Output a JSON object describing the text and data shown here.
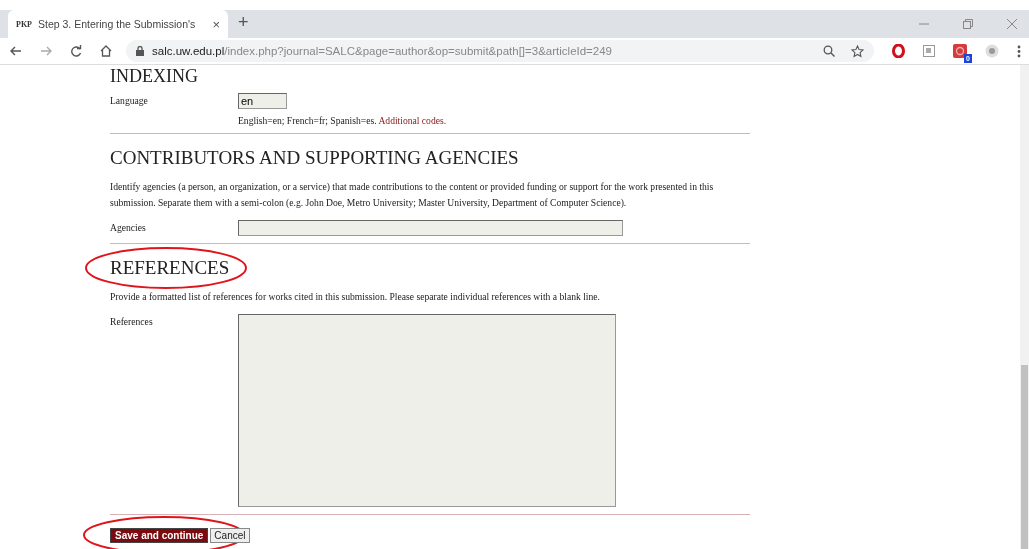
{
  "browser": {
    "tab": {
      "favicon": "PKP",
      "title": "Step 3. Entering the Submission's",
      "close": "×"
    },
    "new_tab": "+",
    "url_host": "salc.uw.edu.pl",
    "url_path": "/index.php?journal=SALC&page=author&op=submit&path[]=3&articleId=249",
    "extension_badge": "0"
  },
  "sections": [
    {
      "heading": "INDEXING",
      "fields": [
        {
          "kind": "text",
          "label": "Language",
          "value": "en",
          "hint": "English=en; French=fr; Spanish=es.",
          "hint_link": "Additional codes."
        }
      ]
    },
    {
      "heading": "CONTRIBUTORS AND SUPPORTING AGENCIES",
      "description": "Identify agencies (a person, an organization, or a service) that made contributions to the content or provided funding or support for the work presented in this submission. Separate them with a semi-colon (e.g. John Doe, Metro University; Master University, Department of Computer Science).",
      "fields": [
        {
          "kind": "wide",
          "label": "Agencies"
        }
      ]
    },
    {
      "heading": "REFERENCES",
      "highlighted": true,
      "description": "Provide a formatted list of references for works cited in this submission. Please separate individual references with a blank line.",
      "fields": [
        {
          "kind": "textarea",
          "label": "References"
        }
      ]
    }
  ],
  "buttons": [
    {
      "label": "Save and continue",
      "kind": "primary",
      "highlighted": true
    },
    {
      "label": "Cancel",
      "kind": "secondary",
      "highlighted": false
    }
  ]
}
